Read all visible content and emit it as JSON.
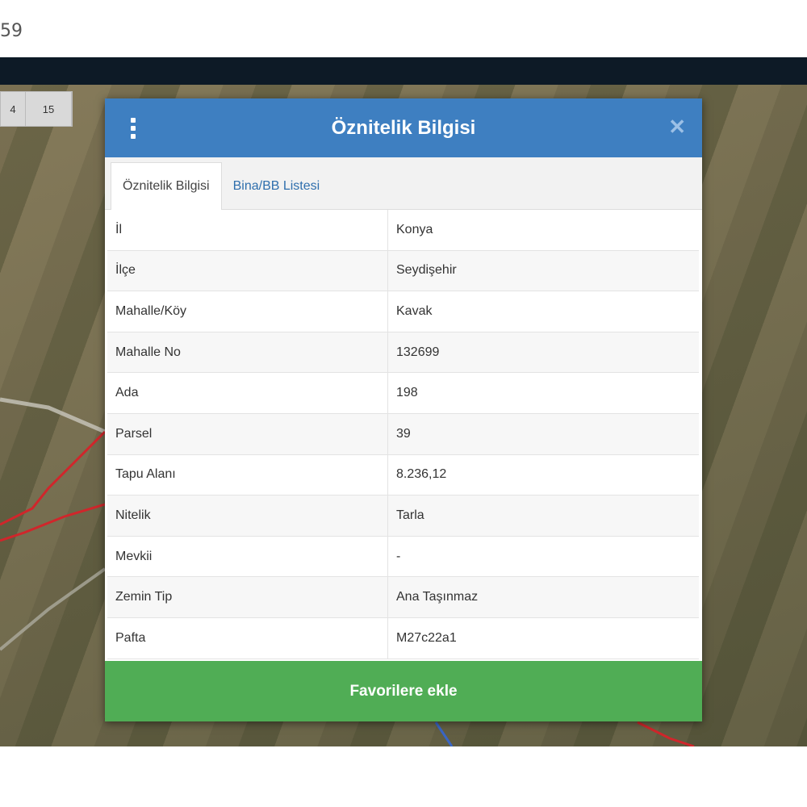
{
  "page": {
    "number_fragment": "59"
  },
  "map_controls": {
    "zoom_levels": [
      "4",
      "15"
    ]
  },
  "modal": {
    "title": "Öznitelik Bilgisi",
    "menu_icon": "vertical-dots-icon",
    "close_icon": "close-icon",
    "tabs": [
      {
        "label": "Öznitelik Bilgisi",
        "active": true
      },
      {
        "label": "Bina/BB Listesi",
        "active": false
      }
    ],
    "attributes": [
      {
        "key": "İl",
        "value": "Konya"
      },
      {
        "key": "İlçe",
        "value": "Seydişehir"
      },
      {
        "key": "Mahalle/Köy",
        "value": "Kavak"
      },
      {
        "key": "Mahalle No",
        "value": "132699"
      },
      {
        "key": "Ada",
        "value": "198"
      },
      {
        "key": "Parsel",
        "value": "39"
      },
      {
        "key": "Tapu Alanı",
        "value": "8.236,12"
      },
      {
        "key": "Nitelik",
        "value": "Tarla"
      },
      {
        "key": "Mevkii",
        "value": "-"
      },
      {
        "key": "Zemin Tip",
        "value": "Ana Taşınmaz"
      },
      {
        "key": "Pafta",
        "value": "M27c22a1"
      }
    ],
    "favorite_button_label": "Favorilere ekle"
  },
  "colors": {
    "header_blue": "#3e7fc1",
    "button_green": "#50ad55",
    "topbar_dark": "#0d1a26",
    "parcel_outline_red": "#d0262b"
  }
}
